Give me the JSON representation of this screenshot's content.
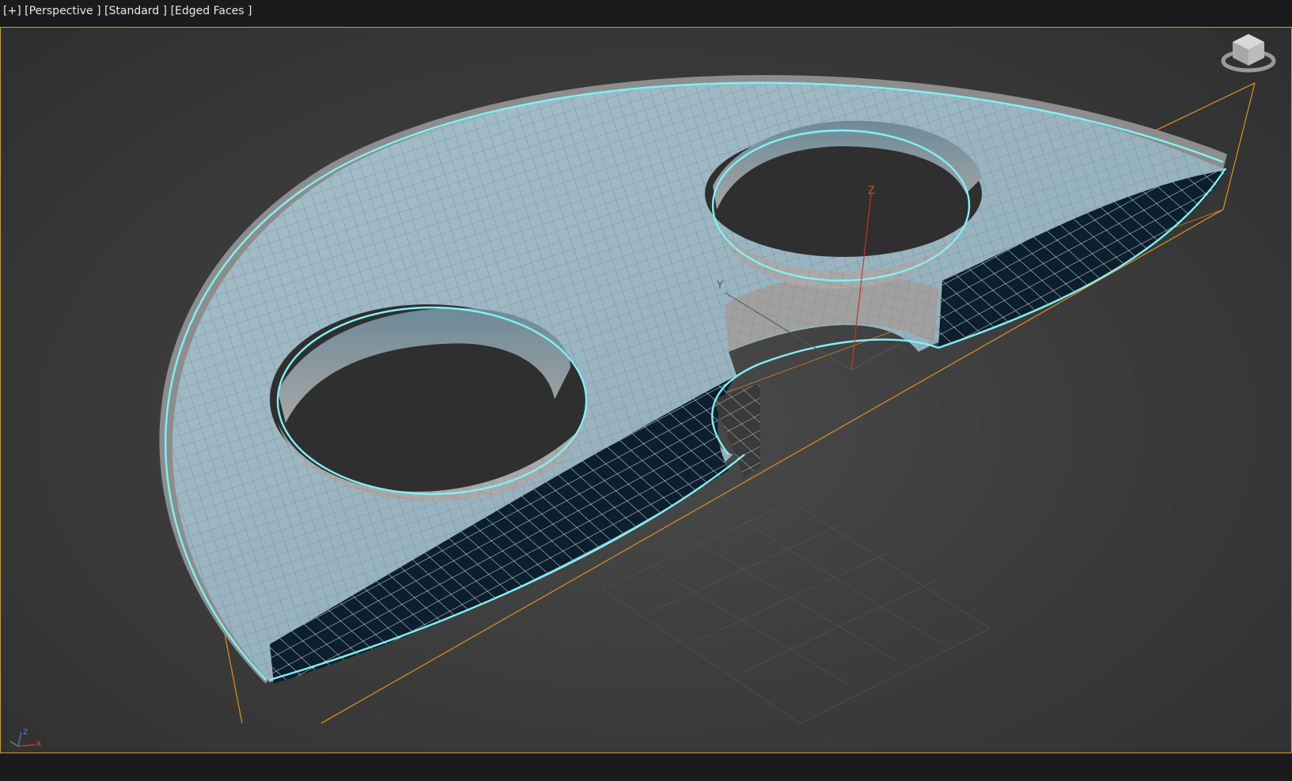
{
  "viewport": {
    "labels": {
      "plus": "[+]",
      "view": "[Perspective ]",
      "shading": "[Standard ]",
      "mode": "[Edged Faces ]"
    },
    "pivot_axes": {
      "z": "Z",
      "y": "Y"
    },
    "tripod_axes": {
      "z": "Z",
      "x": "X"
    },
    "colors": {
      "selection_outline": "#7ff2f6",
      "bounding_box": "#d98a1d",
      "viewport_border": "#c7a23a",
      "mesh_surface": "#9cb6c3",
      "mesh_inside": "#0c1f2c"
    },
    "icons": [
      "viewcube-icon",
      "axis-tripod-icon"
    ]
  }
}
